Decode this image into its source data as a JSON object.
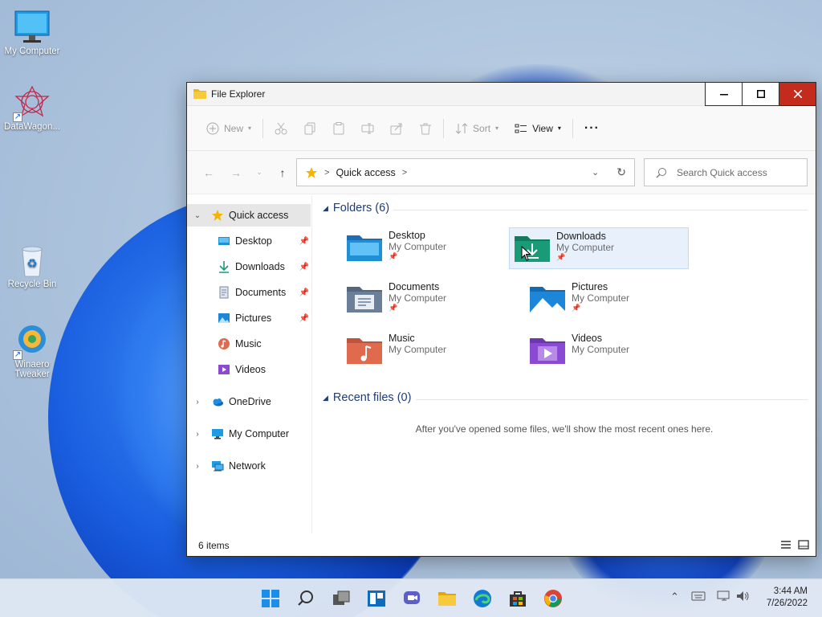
{
  "desktop": {
    "icons": [
      {
        "label": "My Computer",
        "icon": "monitor-icon"
      },
      {
        "label": "DataWagon...",
        "icon": "datawagon-icon"
      },
      {
        "label": "Recycle Bin",
        "icon": "recycle-bin-icon"
      },
      {
        "label": "Winaero Tweaker",
        "icon": "winaero-icon"
      }
    ]
  },
  "window": {
    "title": "File Explorer",
    "controls": {
      "minimize": "minimize-icon",
      "maximize": "maximize-icon",
      "close": "close-icon"
    }
  },
  "toolbar": {
    "new_label": "New",
    "sort_label": "Sort",
    "view_label": "View",
    "more_label": "···",
    "icons": [
      "new-icon",
      "cut-icon",
      "copy-icon",
      "paste-icon",
      "rename-icon",
      "share-icon",
      "delete-icon",
      "sort-icon",
      "view-icon",
      "more-icon"
    ]
  },
  "address": {
    "location": "Quick access",
    "separator": ">",
    "search_placeholder": "Search Quick access"
  },
  "sidebar": {
    "items": [
      {
        "label": "Quick access",
        "icon": "star-icon",
        "expanded": true,
        "selected": true
      },
      {
        "label": "Desktop",
        "icon": "desktop-folder-icon",
        "pinned": true
      },
      {
        "label": "Downloads",
        "icon": "download-icon",
        "pinned": true
      },
      {
        "label": "Documents",
        "icon": "documents-icon",
        "pinned": true
      },
      {
        "label": "Pictures",
        "icon": "pictures-icon",
        "pinned": true
      },
      {
        "label": "Music",
        "icon": "music-icon"
      },
      {
        "label": "Videos",
        "icon": "videos-icon"
      },
      {
        "label": "OneDrive",
        "icon": "cloud-icon"
      },
      {
        "label": "My Computer",
        "icon": "monitor-icon"
      },
      {
        "label": "Network",
        "icon": "network-icon"
      }
    ]
  },
  "content": {
    "folders_heading": "Folders (6)",
    "folders": [
      {
        "name": "Desktop",
        "location": "My Computer",
        "pinned": true,
        "color": "#1f8fd6"
      },
      {
        "name": "Downloads",
        "location": "My Computer",
        "pinned": true,
        "selected": true,
        "color": "#1a9b78"
      },
      {
        "name": "Documents",
        "location": "My Computer",
        "pinned": true,
        "color": "#6b7f99"
      },
      {
        "name": "Pictures",
        "location": "My Computer",
        "pinned": true,
        "color": "#1c86d8"
      },
      {
        "name": "Music",
        "location": "My Computer",
        "pinned": false,
        "color": "#e06a4e"
      },
      {
        "name": "Videos",
        "location": "My Computer",
        "pinned": false,
        "color": "#8b4ad3"
      }
    ],
    "recent_heading": "Recent files (0)",
    "recent_empty_message": "After you've opened some files, we'll show the most recent ones here."
  },
  "statusbar": {
    "items_count": "6 items"
  },
  "taskbar": {
    "icons": [
      "start-icon",
      "search-icon",
      "task-view-icon",
      "widgets-icon",
      "chat-icon",
      "file-explorer-icon",
      "edge-icon",
      "store-icon",
      "chrome-icon"
    ],
    "tray_icons": [
      "chevron-up-icon",
      "keyboard-icon",
      "network-tray-icon",
      "volume-icon"
    ],
    "time": "3:44 AM",
    "date": "7/26/2022"
  }
}
